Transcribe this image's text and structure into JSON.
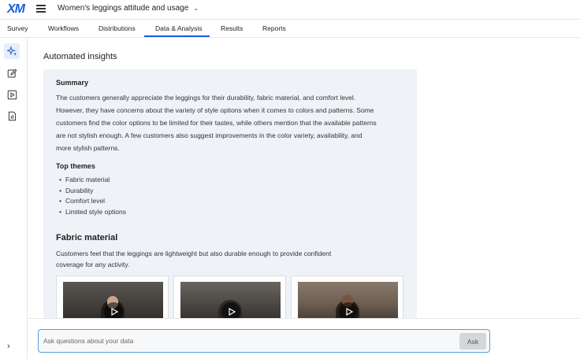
{
  "app": {
    "logo": "XM",
    "project_title": "Women's leggings attitude and usage"
  },
  "tabs": [
    {
      "label": "Survey"
    },
    {
      "label": "Workflows"
    },
    {
      "label": "Distributions"
    },
    {
      "label": "Data & Analysis",
      "active": true
    },
    {
      "label": "Results"
    },
    {
      "label": "Reports"
    }
  ],
  "rail": {
    "items": [
      {
        "icon": "sparkle-icon",
        "active": true
      },
      {
        "icon": "edit-icon"
      },
      {
        "icon": "play-box-icon"
      },
      {
        "icon": "report-icon"
      }
    ],
    "expand_icon": "›"
  },
  "insights": {
    "section_title": "Automated insights",
    "summary_heading": "Summary",
    "summary_text": "The customers generally appreciate the leggings for their durability, fabric material, and comfort level. However, they have concerns about the variety of style options when it comes to colors and patterns. Some customers find the color options to be limited for their tastes, while others mention that the available patterns are not stylish enough. A few customers also suggest improvements in the color variety, availability, and more stylish patterns.",
    "themes_heading": "Top themes",
    "themes": [
      "Fabric material",
      "Durability",
      "Comfort level",
      "Limited style options"
    ],
    "theme_detail": {
      "title": "Fabric material",
      "description": "Customers feel that the leggings are lightweight but also durable enough to provide confident coverage for any activity."
    }
  },
  "ask": {
    "placeholder": "Ask questions about your data",
    "button_label": "Ask"
  },
  "colors": {
    "accent": "#1a5fd6",
    "card_bg": "#eff3f8"
  }
}
